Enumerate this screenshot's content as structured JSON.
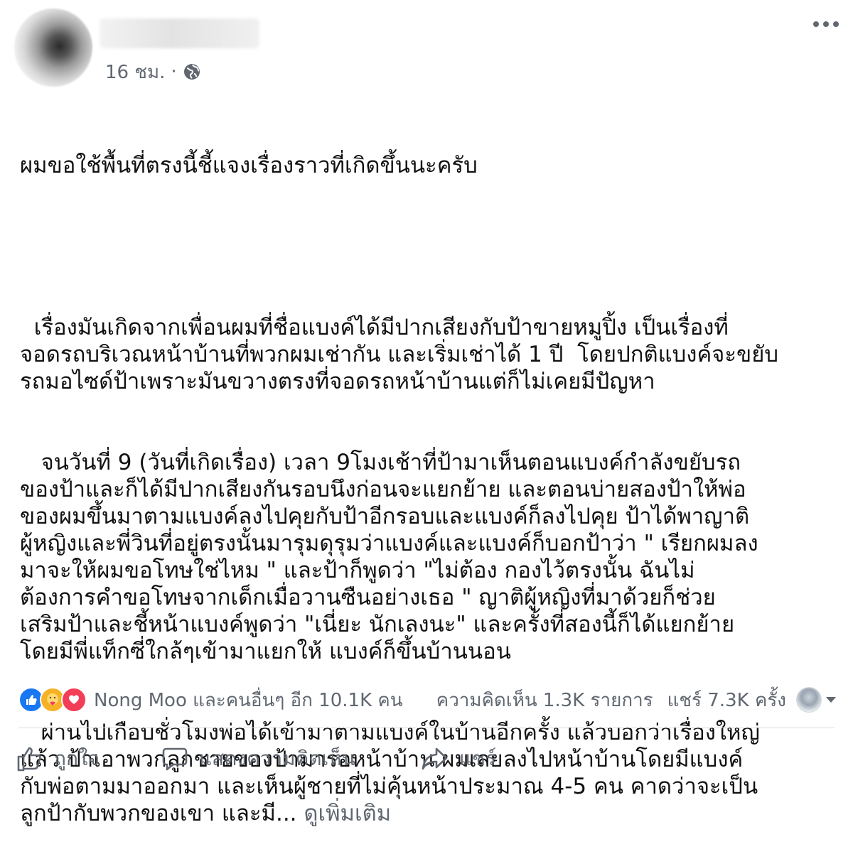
{
  "header": {
    "time": "16 ชม.",
    "separator": "·",
    "privacy_icon": "globe-icon"
  },
  "post": {
    "paragraphs": [
      "ผมขอใช้พื้นที่ตรงนี้ชี้แจงเรื่องราวที่เกิดขึ้นนะครับ",
      "",
      "  เรื่องมันเกิดจากเพื่อนผมที่ชื่อแบงค์ได้มีปากเสียงกับป้าขายหมูปิ้ง เป็นเรื่องที่\nจอดรถบริเวณหน้าบ้านที่พวกผมเช่ากัน และเริ่มเช่าได้ 1 ปี  โดยปกติแบงค์จะขยับ\nรถมอไซด์ป้าเพราะมันขวางตรงที่จอดรถหน้าบ้านแต่ก็ไม่เคยมีปัญหา",
      "   จนวันที่ 9 (วันที่เกิดเรื่อง) เวลา 9โมงเช้าที่ป้ามาเห็นตอนแบงค์กำลังขยับรถ\nของป้าและก็ได้มีปากเสียงกันรอบนึงก่อนจะแยกย้าย และตอนบ่ายสองป้าให้พ่อ\nของผมขึ้นมาตามแบงค์ลงไปคุยกับป้าอีกรอบและแบงค์ก็ลงไปคุย ป้าได้พาญาติ\nผู้หญิงและพี่วินที่อยู่ตรงนั้นมารุมดุรุมว่าแบงค์และแบงค์ก็บอกป้าว่า \" เรียกผมลง\nมาจะให้ผมขอโทษใช่ไหม \" และป้าก็พูดว่า \"ไม่ต้อง กองไว้ตรงนั้น ฉันไม่\nต้องการคำขอโทษจากเด็กเมื่อวานซืนอย่างเธอ \" ญาติผู้หญิงที่มาด้วยก็ช่วย\nเสริมป้าและชี้หน้าแบงค์พูดว่า \"เนี่ยะ นักเลงนะ\" และครั้งที่สองนี้ก็ได้แยกย้าย\nโดยมีพี่แท็กซี่ใกล้ๆเข้ามาแยกให้ แบงค์ก็ขึ้นบ้านนอน",
      "   ผ่านไปเกือบชั่วโมงพ่อได้เข้ามาตามแบงค์ในบ้านอีกครั้ง แล้วบอกว่าเรื่องใหญ่\nแล้ว ป้าเอาพวกลูกชายของป้ามารอหน้าบ้าน ผมเลยลงไปหน้าบ้านโดยมีแบงค์\nกับพ่อตามมาออกมา และเห็นผู้ชายที่ไม่คุ้นหน้าประมาณ 4-5 คน คาดว่าจะเป็น\nลูกป้ากับพวกของเขา และมี..."
    ],
    "see_more": "ดูเพิ่มเติม"
  },
  "stats": {
    "reaction_icons": [
      "like-icon",
      "care-icon",
      "love-icon"
    ],
    "reactions_text": "Nong Moo และคนอื่นๆ อีก 10.1K คน",
    "comments_text": "ความคิดเห็น 1.3K รายการ",
    "shares_text": "แชร์ 7.3K ครั้ง"
  },
  "actions": {
    "like": "ถูกใจ",
    "comment": "แสดงความคิดเห็น",
    "share": "แชร์"
  },
  "colors": {
    "text": "#111111",
    "secondary": "#606770",
    "like_blue": "#1877f2",
    "love_red": "#f33e58",
    "care_yellow": "#f7b125",
    "divider": "#dadde1"
  }
}
